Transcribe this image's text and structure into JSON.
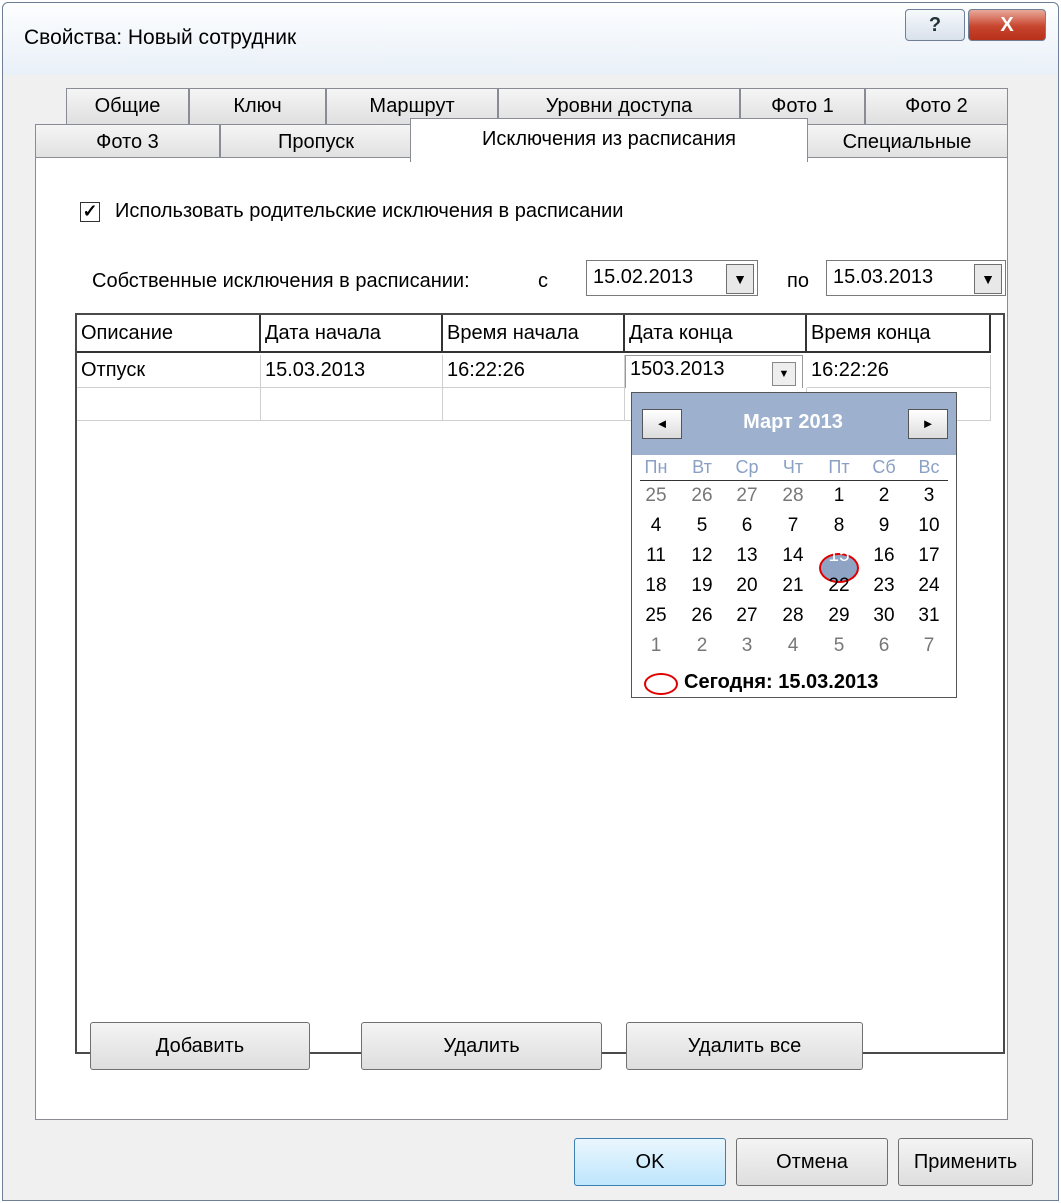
{
  "window": {
    "title": "Свойства: Новый сотрудник",
    "help_label": "?",
    "close_label": "X"
  },
  "tabs": {
    "row1": [
      "Общие",
      "Ключ",
      "Маршрут",
      "Уровни доступа",
      "Фото 1",
      "Фото 2"
    ],
    "row2": [
      "Фото 3",
      "Пропуск",
      "Исключения из расписания",
      "Специальные"
    ],
    "active": "Исключения из расписания"
  },
  "exceptions": {
    "use_parent_label": "Использовать родительские исключения в расписании",
    "use_parent_checked": true,
    "check_mark": "✓",
    "own_label": "Собственные исключения в расписании:",
    "from_label": "с",
    "from_value": "15.02.2013",
    "to_label": "по",
    "to_value": "15.03.2013",
    "dropdown_icon": "▼"
  },
  "grid": {
    "columns": [
      "Описание",
      "Дата начала",
      "Время начала",
      "Дата конца",
      "Время конца"
    ],
    "row": {
      "description": "Отпуск",
      "start_date": "15.03.2013",
      "start_time": "16:22:26",
      "end_date_editing": "1503.2013",
      "end_time": "16:22:26"
    },
    "editor_dropdown_icon": "▼"
  },
  "calendar": {
    "month_label": "Март 2013",
    "prev_icon": "◄",
    "next_icon": "►",
    "weekdays": [
      "Пн",
      "Вт",
      "Ср",
      "Чт",
      "Пт",
      "Сб",
      "Вс"
    ],
    "weeks": [
      [
        "25",
        "26",
        "27",
        "28",
        "1",
        "2",
        "3"
      ],
      [
        "4",
        "5",
        "6",
        "7",
        "8",
        "9",
        "10"
      ],
      [
        "11",
        "12",
        "13",
        "14",
        "15",
        "16",
        "17"
      ],
      [
        "18",
        "19",
        "20",
        "21",
        "22",
        "23",
        "24"
      ],
      [
        "25",
        "26",
        "27",
        "28",
        "29",
        "30",
        "31"
      ],
      [
        "1",
        "2",
        "3",
        "4",
        "5",
        "6",
        "7"
      ]
    ],
    "selected_day": "15",
    "today_label": "Сегодня: 15.03.2013"
  },
  "buttons": {
    "add": "Добавить",
    "delete": "Удалить",
    "delete_all": "Удалить все",
    "ok": "OK",
    "cancel": "Отмена",
    "apply": "Применить"
  }
}
